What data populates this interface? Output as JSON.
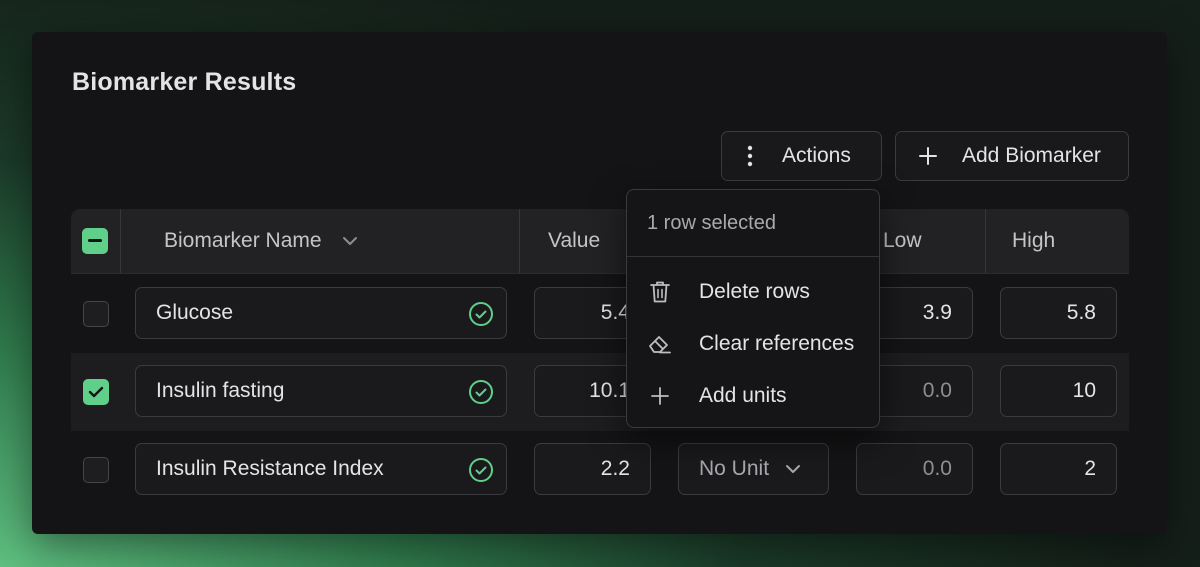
{
  "panel": {
    "title": "Biomarker Results",
    "actions_label": "Actions",
    "add_label": "Add Biomarker"
  },
  "table": {
    "headers": {
      "name": "Biomarker Name",
      "value": "Value",
      "low": "Low",
      "high": "High"
    },
    "rows": [
      {
        "name": "Glucose",
        "value": "5.4",
        "unit": "",
        "low": "3.9",
        "high": "5.8",
        "checked": false
      },
      {
        "name": "Insulin fasting",
        "value": "10.1",
        "unit": "",
        "low": "0.0",
        "high": "10",
        "checked": true
      },
      {
        "name": "Insulin Resistance Index",
        "value": "2.2",
        "unit": "No Unit",
        "low": "0.0",
        "high": "2",
        "checked": false
      }
    ]
  },
  "menu": {
    "header": "1 row selected",
    "items": [
      {
        "label": "Delete rows",
        "icon": "trash-icon"
      },
      {
        "label": "Clear references",
        "icon": "eraser-icon"
      },
      {
        "label": "Add units",
        "icon": "plus-icon"
      }
    ]
  },
  "colors": {
    "accent": "#5fcf8a",
    "panel_bg": "#141416",
    "text": "#e4e4e6"
  }
}
